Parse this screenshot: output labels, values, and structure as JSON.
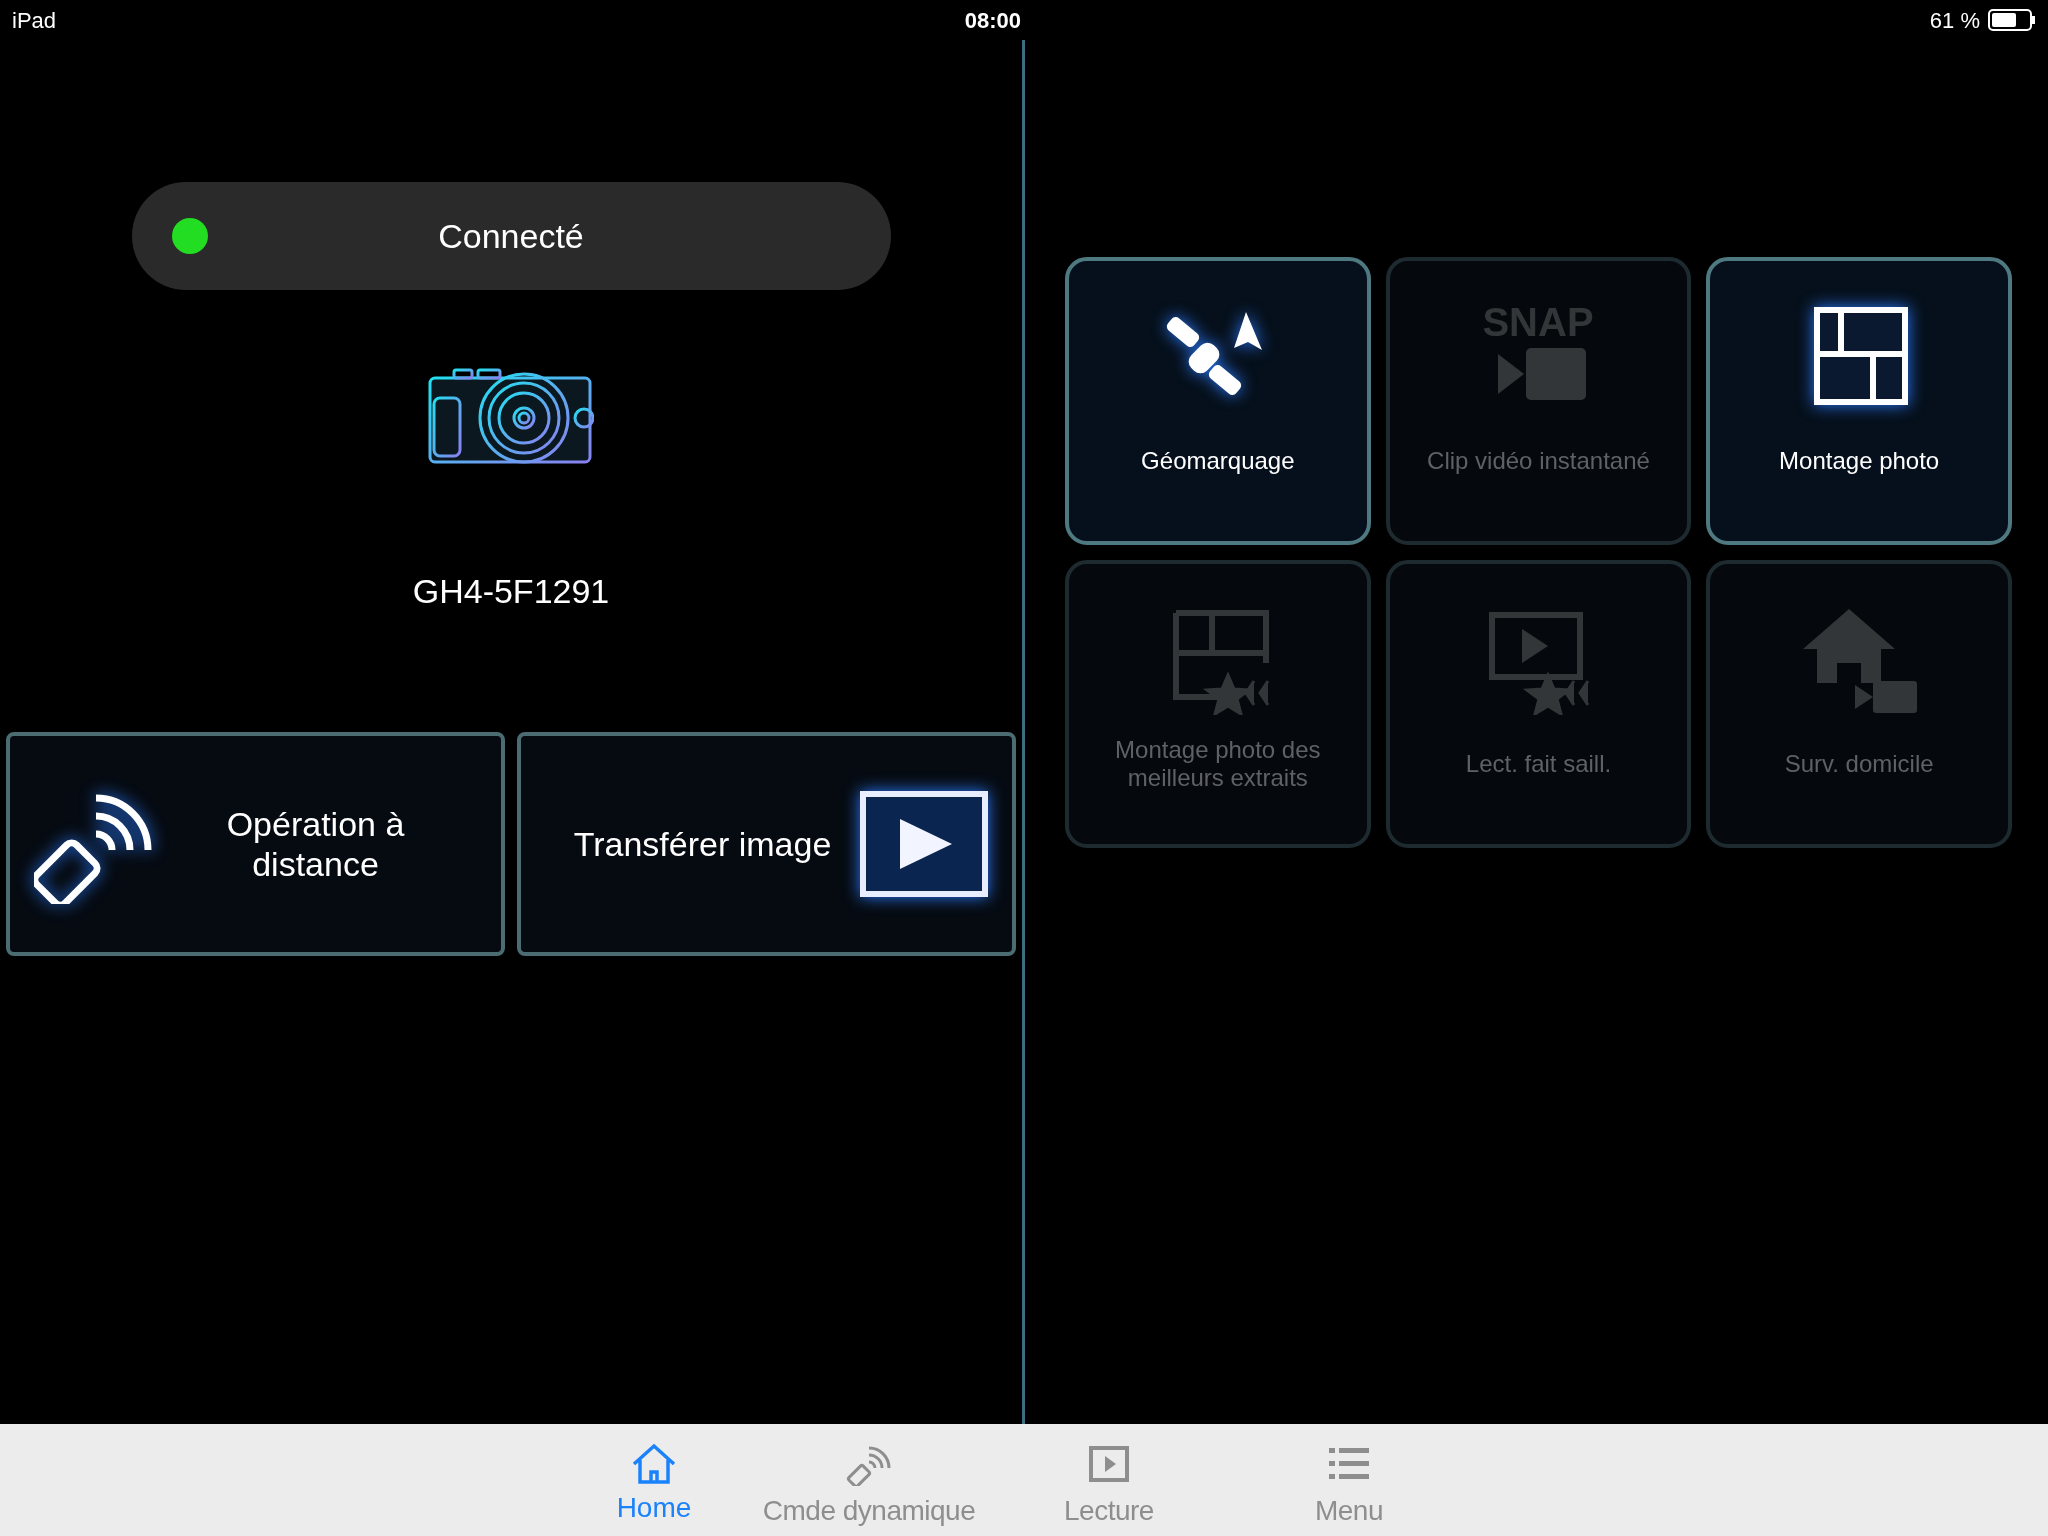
{
  "status_bar": {
    "device": "iPad",
    "time": "08:00",
    "battery": "61 %"
  },
  "connection": {
    "label": "Connecté",
    "color": "#22dd22"
  },
  "camera": {
    "name": "GH4-5F1291"
  },
  "actions": [
    {
      "kind": "remote",
      "label": "Opération à distance"
    },
    {
      "kind": "transfer",
      "label": "Transférer image"
    }
  ],
  "tiles": [
    {
      "kind": "geotag",
      "label": "Géomarquage",
      "disabled": false
    },
    {
      "kind": "snap",
      "icon_text": "SNAP",
      "label": "Clip vidéo instantané",
      "disabled": true
    },
    {
      "kind": "collage",
      "label": "Montage photo",
      "disabled": false
    },
    {
      "kind": "highlight-collage",
      "label": "Montage photo des meilleurs extraits",
      "disabled": true
    },
    {
      "kind": "highlight-play",
      "label": "Lect. fait saill.",
      "disabled": true
    },
    {
      "kind": "home-monitor",
      "label": "Surv. domicile",
      "disabled": true
    }
  ],
  "tab_bar": [
    {
      "kind": "home",
      "label": "Home",
      "selected": true
    },
    {
      "kind": "remote",
      "label": "Cmde dynamique",
      "selected": false
    },
    {
      "kind": "playback",
      "label": "Lecture",
      "selected": false
    },
    {
      "kind": "menu",
      "label": "Menu",
      "selected": false
    }
  ]
}
